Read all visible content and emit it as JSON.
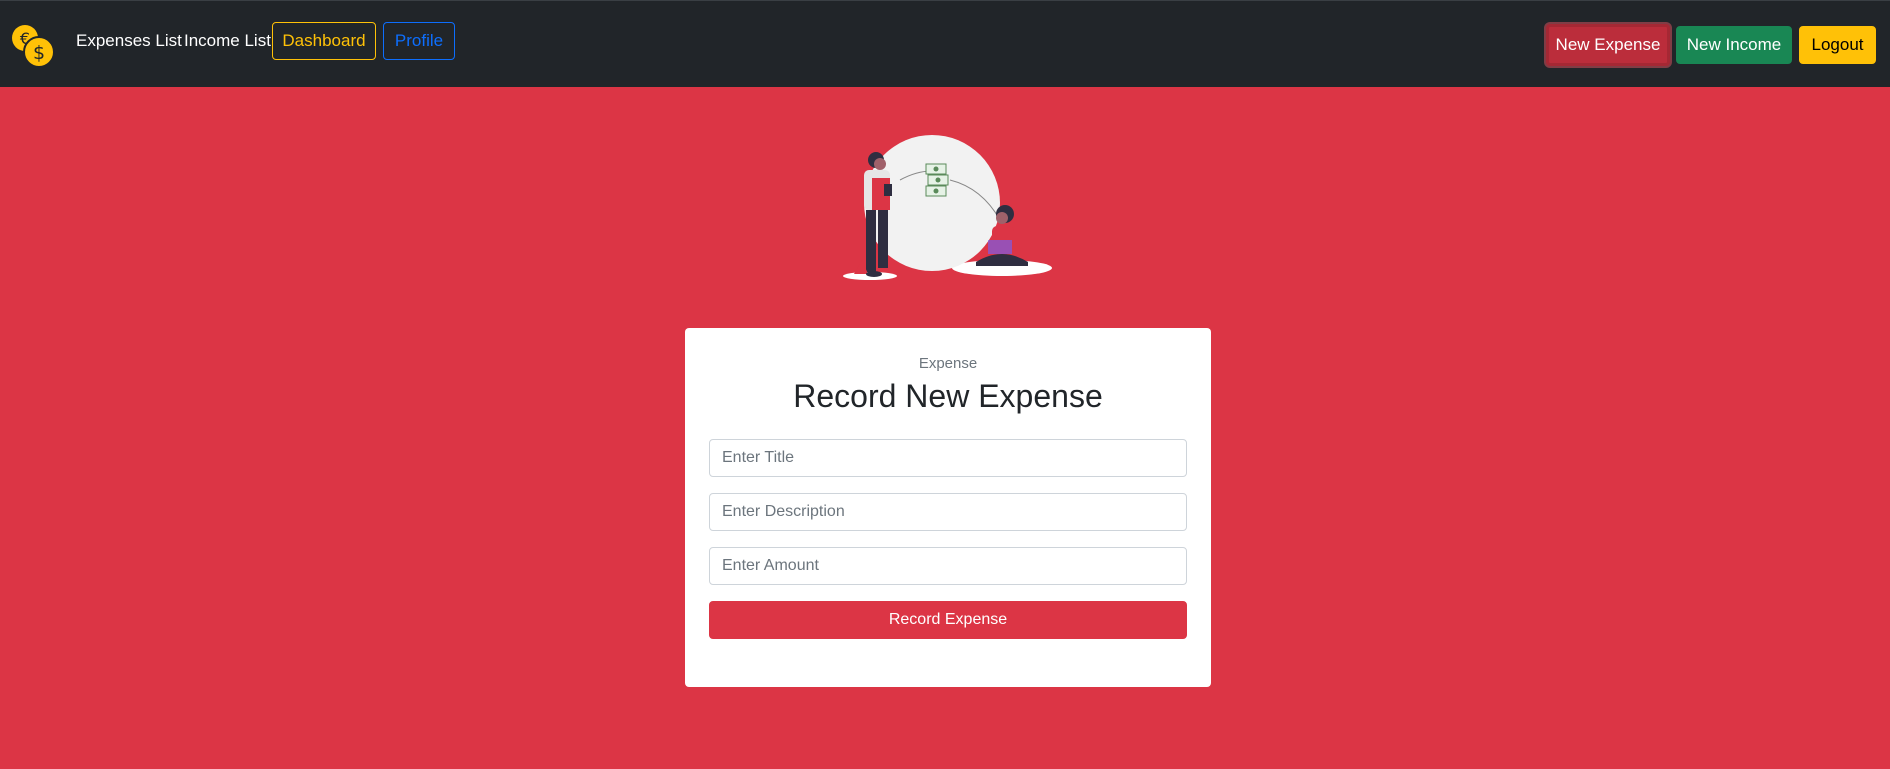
{
  "nav": {
    "logo_icon": "coins-icon",
    "expenses_list": "Expenses List",
    "income_list": "Income List",
    "dashboard": "Dashboard",
    "profile": "Profile",
    "new_expense": "New Expense",
    "new_income": "New Income",
    "logout": "Logout"
  },
  "form": {
    "subtitle": "Expense",
    "title": "Record New Expense",
    "title_placeholder": "Enter Title",
    "description_placeholder": "Enter Description",
    "amount_placeholder": "Enter Amount",
    "submit": "Record Expense"
  },
  "colors": {
    "background": "#dc3545",
    "navbar": "#212529",
    "warning": "#ffc107",
    "primary": "#0d6efd",
    "success": "#198754"
  }
}
